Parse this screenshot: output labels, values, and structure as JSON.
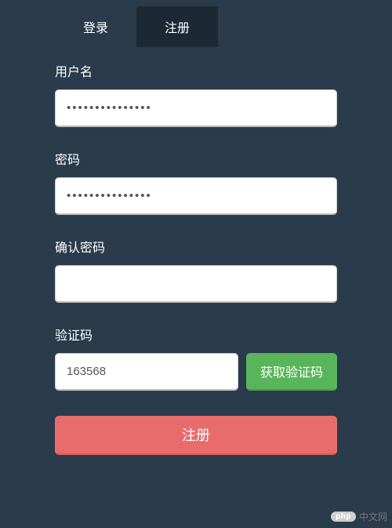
{
  "tabs": {
    "login": "登录",
    "register": "注册"
  },
  "form": {
    "username": {
      "label": "用户名",
      "value": "usernameexample"
    },
    "password": {
      "label": "密码",
      "value": "passwordexample"
    },
    "confirm_password": {
      "label": "确认密码",
      "value": ""
    },
    "captcha": {
      "label": "验证码",
      "value": "163568",
      "button": "获取验证码"
    },
    "submit": "注册"
  },
  "watermark": {
    "badge": "php",
    "text": "中文网"
  }
}
